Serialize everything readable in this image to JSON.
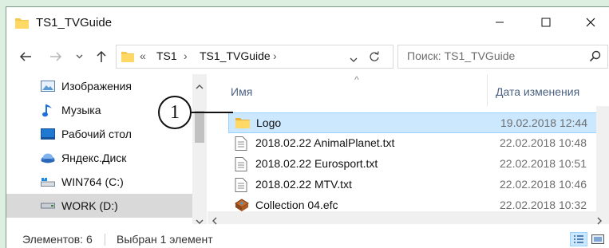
{
  "window": {
    "title": "TS1_TVGuide"
  },
  "address": {
    "overflow": "«",
    "crumbs": [
      "TS1",
      "TS1_TVGuide"
    ],
    "separator": "›"
  },
  "search": {
    "placeholder": "Поиск: TS1_TVGuide"
  },
  "nav_pane": {
    "items": [
      {
        "label": "Изображения",
        "icon": "pictures-icon"
      },
      {
        "label": "Музыка",
        "icon": "music-icon"
      },
      {
        "label": "Рабочий стол",
        "icon": "desktop-icon"
      },
      {
        "label": "Яндекс.Диск",
        "icon": "cloud-disk-icon"
      },
      {
        "label": "WIN764 (C:)",
        "icon": "drive-icon"
      },
      {
        "label": "WORK (D:)",
        "icon": "drive-icon"
      }
    ],
    "selected_index": 5
  },
  "file_list": {
    "columns": {
      "name": "Имя",
      "date": "Дата изменения"
    },
    "sort_arrow": "^",
    "rows": [
      {
        "name": "Logo",
        "date": "19.02.2018 12:44",
        "icon": "folder-icon",
        "selected": true
      },
      {
        "name": "2018.02.22 AnimalPlanet.txt",
        "date": "22.02.2018 10:48",
        "icon": "text-file-icon"
      },
      {
        "name": "2018.02.22 Eurosport.txt",
        "date": "22.02.2018 10:51",
        "icon": "text-file-icon"
      },
      {
        "name": "2018.02.22 MTV.txt",
        "date": "22.02.2018 10:46",
        "icon": "text-file-icon"
      },
      {
        "name": "Collection 04.efc",
        "date": "22.02.2018 10:32",
        "icon": "efc-file-icon"
      }
    ]
  },
  "callout": {
    "number": "1"
  },
  "status": {
    "items_count": "Элементов: 6",
    "selection": "Выбран 1 элемент"
  },
  "colors": {
    "selection_bg": "#cce8ff",
    "folder_yellow": "#f4c84a",
    "header_text": "#4d6282"
  }
}
